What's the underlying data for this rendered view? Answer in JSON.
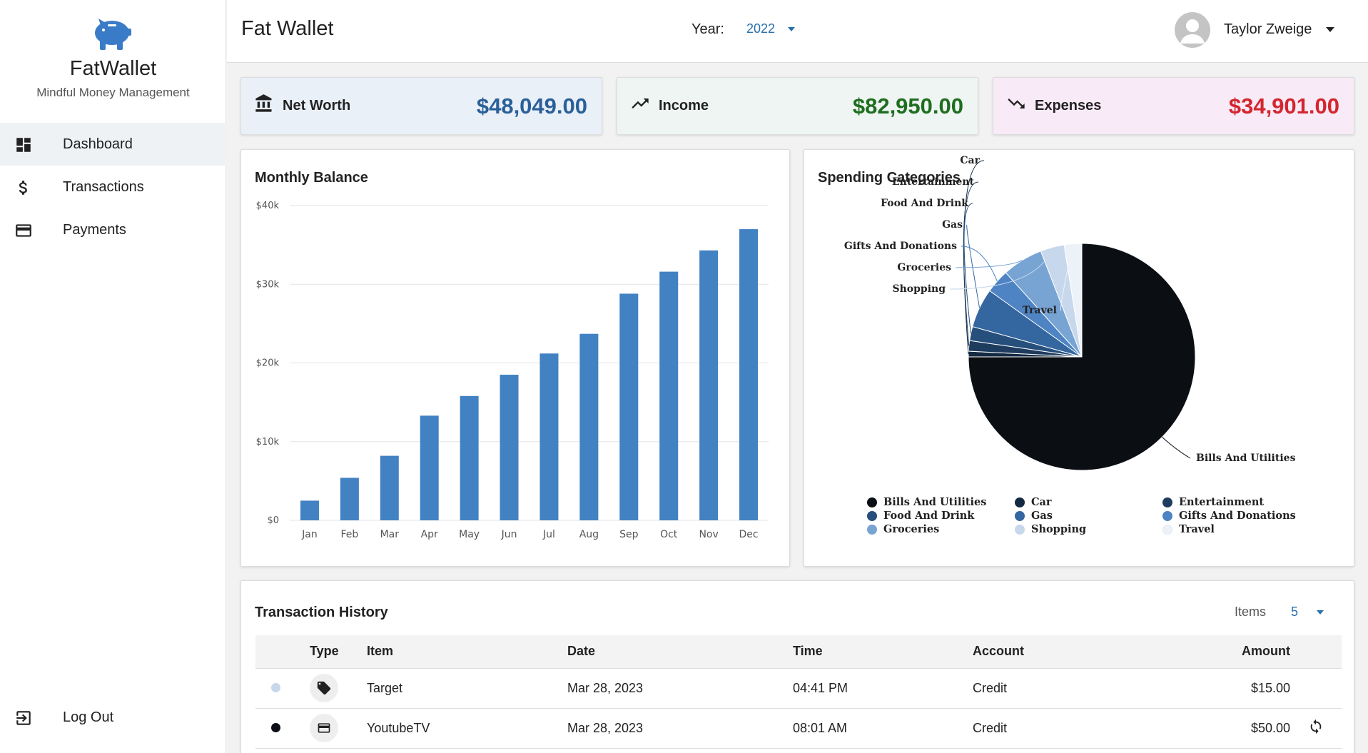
{
  "brand": {
    "name": "FatWallet",
    "tagline": "Mindful Money Management",
    "icon": "piggy-bank-icon"
  },
  "nav": {
    "items": [
      {
        "label": "Dashboard",
        "icon": "dashboard-icon",
        "active": true
      },
      {
        "label": "Transactions",
        "icon": "dollar-icon"
      },
      {
        "label": "Payments",
        "icon": "credit-card-icon"
      }
    ],
    "logout_label": "Log Out"
  },
  "header": {
    "title": "Fat Wallet",
    "year_label": "Year:",
    "year_value": "2022",
    "user_name": "Taylor Zweige"
  },
  "stats": {
    "net_worth": {
      "label": "Net Worth",
      "value": "$48,049.00",
      "color": "#2a6099",
      "bg": "#eaf0f8",
      "icon": "bank-icon"
    },
    "income": {
      "label": "Income",
      "value": "$82,950.00",
      "color": "#1f6e1f",
      "bg": "#eef5f3",
      "icon": "trending-up-icon"
    },
    "expenses": {
      "label": "Expenses",
      "value": "$34,901.00",
      "color": "#d3262e",
      "bg": "#f8eaf7",
      "icon": "trending-down-icon"
    }
  },
  "monthly_balance": {
    "title": "Monthly Balance"
  },
  "spending": {
    "title": "Spending Categories"
  },
  "chart_data": [
    {
      "type": "bar",
      "title": "Monthly Balance",
      "categories": [
        "Jan",
        "Feb",
        "Mar",
        "Apr",
        "May",
        "Jun",
        "Jul",
        "Aug",
        "Sep",
        "Oct",
        "Nov",
        "Dec"
      ],
      "values": [
        2500,
        5400,
        8200,
        13300,
        15800,
        18500,
        21200,
        23700,
        28800,
        31600,
        34300,
        37000
      ],
      "ylim": [
        0,
        40000
      ],
      "yticks": [
        "$0",
        "$10k",
        "$20k",
        "$30k",
        "$40k"
      ],
      "ytick_values": [
        0,
        10000,
        20000,
        30000,
        40000
      ],
      "grid": true,
      "color": "#4282c2"
    },
    {
      "type": "pie",
      "title": "Spending Categories",
      "categories": [
        "Bills And Utilities",
        "Car",
        "Entertainment",
        "Food And Drink",
        "Gas",
        "Gifts And Donations",
        "Groceries",
        "Shopping",
        "Travel"
      ],
      "values": [
        75.0,
        0.8,
        1.5,
        2.0,
        5.6,
        3.4,
        5.8,
        3.4,
        2.5
      ],
      "colors": [
        "#0b0f14",
        "#142a43",
        "#1e3c5e",
        "#264f7c",
        "#3466a0",
        "#4e83c4",
        "#78a4d4",
        "#c7d8ec",
        "#edf2f9"
      ],
      "legend": "bottom"
    }
  ],
  "transactions": {
    "title": "Transaction History",
    "items_label": "Items",
    "items_value": "5",
    "columns": [
      "",
      "Type",
      "Item",
      "Date",
      "Time",
      "Account",
      "Amount",
      ""
    ],
    "rows": [
      {
        "dot_color": "#c7d8ec",
        "type_icon": "tag-icon",
        "item": "Target",
        "date": "Mar 28, 2023",
        "time": "04:41 PM",
        "account": "Credit",
        "amount": "$15.00",
        "recurring": false
      },
      {
        "dot_color": "#0b0f14",
        "type_icon": "credit-card-icon",
        "item": "YoutubeTV",
        "date": "Mar 28, 2023",
        "time": "08:01 AM",
        "account": "Credit",
        "amount": "$50.00",
        "recurring": true,
        "recurring_icon": "sync-icon"
      }
    ]
  }
}
